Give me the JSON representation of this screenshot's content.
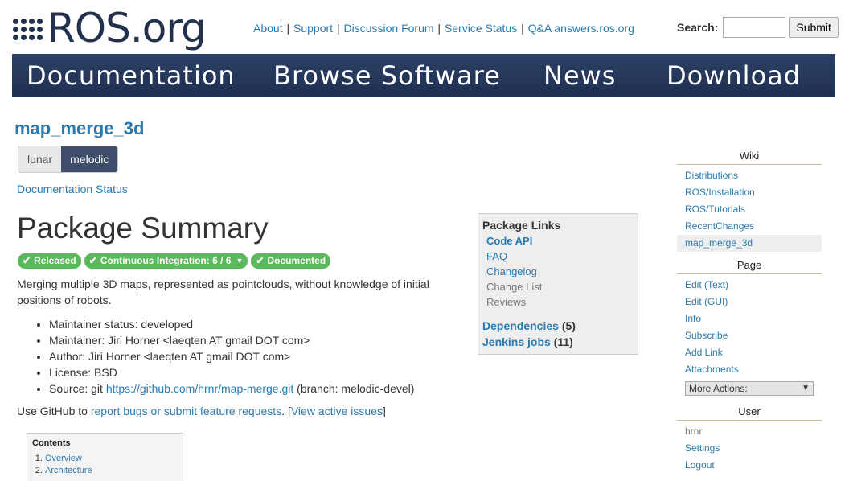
{
  "header": {
    "logo_text": "ROS.org",
    "top_links": [
      "About",
      "Support",
      "Discussion Forum",
      "Service Status",
      "Q&A answers.ros.org"
    ],
    "search_label": "Search:",
    "search_value": "",
    "search_button": "Submit"
  },
  "nav": [
    "Documentation",
    "Browse Software",
    "News",
    "Download"
  ],
  "package": {
    "title": "map_merge_3d",
    "distros": [
      "lunar",
      "melodic"
    ],
    "active_distro": "melodic",
    "doc_status": "Documentation Status",
    "summary_heading": "Package Summary",
    "badges": [
      "Released",
      "Continuous Integration: 6 / 6",
      "Documented"
    ],
    "description": "Merging multiple 3D maps, represented as pointclouds, without knowledge of initial positions of robots.",
    "info": {
      "maintainer_status": "Maintainer status: developed",
      "maintainer": "Maintainer: Jiri Horner <laeqten AT gmail DOT com>",
      "author": "Author: Jiri Horner <laeqten AT gmail DOT com>",
      "license": "License: BSD",
      "source_prefix": "Source: git ",
      "source_url": "https://github.com/hrnr/map-merge.git",
      "source_suffix": " (branch: melodic-devel)"
    },
    "github": {
      "prefix": "Use GitHub to ",
      "report_link": "report bugs or submit feature requests",
      "middle": ". [",
      "issues_link": "View active issues",
      "suffix": "]"
    },
    "contents": {
      "title": "Contents",
      "items": [
        "Overview",
        "Architecture"
      ]
    }
  },
  "package_links": {
    "title": "Package Links",
    "links": [
      "Code API",
      "FAQ",
      "Changelog",
      "Change List",
      "Reviews"
    ],
    "dependencies_label": "Dependencies",
    "dependencies_count": "(5)",
    "jenkins_label": "Jenkins jobs",
    "jenkins_count": "(11)"
  },
  "sidebar": {
    "wiki_title": "Wiki",
    "wiki_links": [
      "Distributions",
      "ROS/Installation",
      "ROS/Tutorials",
      "RecentChanges",
      "map_merge_3d"
    ],
    "page_title": "Page",
    "page_links": [
      "Edit (Text)",
      "Edit (GUI)",
      "Info",
      "Subscribe",
      "Add Link",
      "Attachments"
    ],
    "more_actions": "More Actions:",
    "user_title": "User",
    "user_name": "hrnr",
    "user_links": [
      "Settings",
      "Logout"
    ]
  },
  "colors": {
    "navbar": "#22314e",
    "link": "#2a7ab0",
    "badge": "#5cb85c"
  }
}
